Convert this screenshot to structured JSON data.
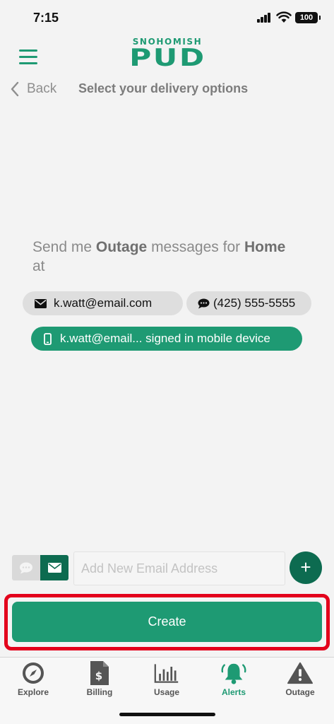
{
  "status": {
    "time": "7:15",
    "battery": "100"
  },
  "header": {
    "logo_top": "SNOHOMISH",
    "logo_main": "PUD",
    "back_label": "Back",
    "title": "Select your delivery options"
  },
  "message": {
    "prefix": "Send me ",
    "alert_type": "Outage",
    "middle": " messages for ",
    "location": "Home",
    "suffix": " at"
  },
  "options": [
    {
      "label": "k.watt@email.com",
      "icon": "envelope-icon",
      "selected": false
    },
    {
      "label": "(425) 555-5555",
      "icon": "chat-bubble-icon",
      "selected": false
    },
    {
      "label": "k.watt@email... signed in mobile device",
      "icon": "mobile-device-icon",
      "selected": true
    }
  ],
  "compose": {
    "placeholder": "Add New Email Address",
    "add_label": "+"
  },
  "create_label": "Create",
  "tabs": [
    {
      "label": "Explore",
      "icon": "compass-icon",
      "active": false
    },
    {
      "label": "Billing",
      "icon": "bill-icon",
      "active": false
    },
    {
      "label": "Usage",
      "icon": "bar-chart-icon",
      "active": false
    },
    {
      "label": "Alerts",
      "icon": "bell-icon",
      "active": true
    },
    {
      "label": "Outage",
      "icon": "warning-icon",
      "active": false
    }
  ],
  "colors": {
    "brand_green": "#1e9a73",
    "dark_green": "#0d6b50",
    "highlight_red": "#e3001b"
  }
}
